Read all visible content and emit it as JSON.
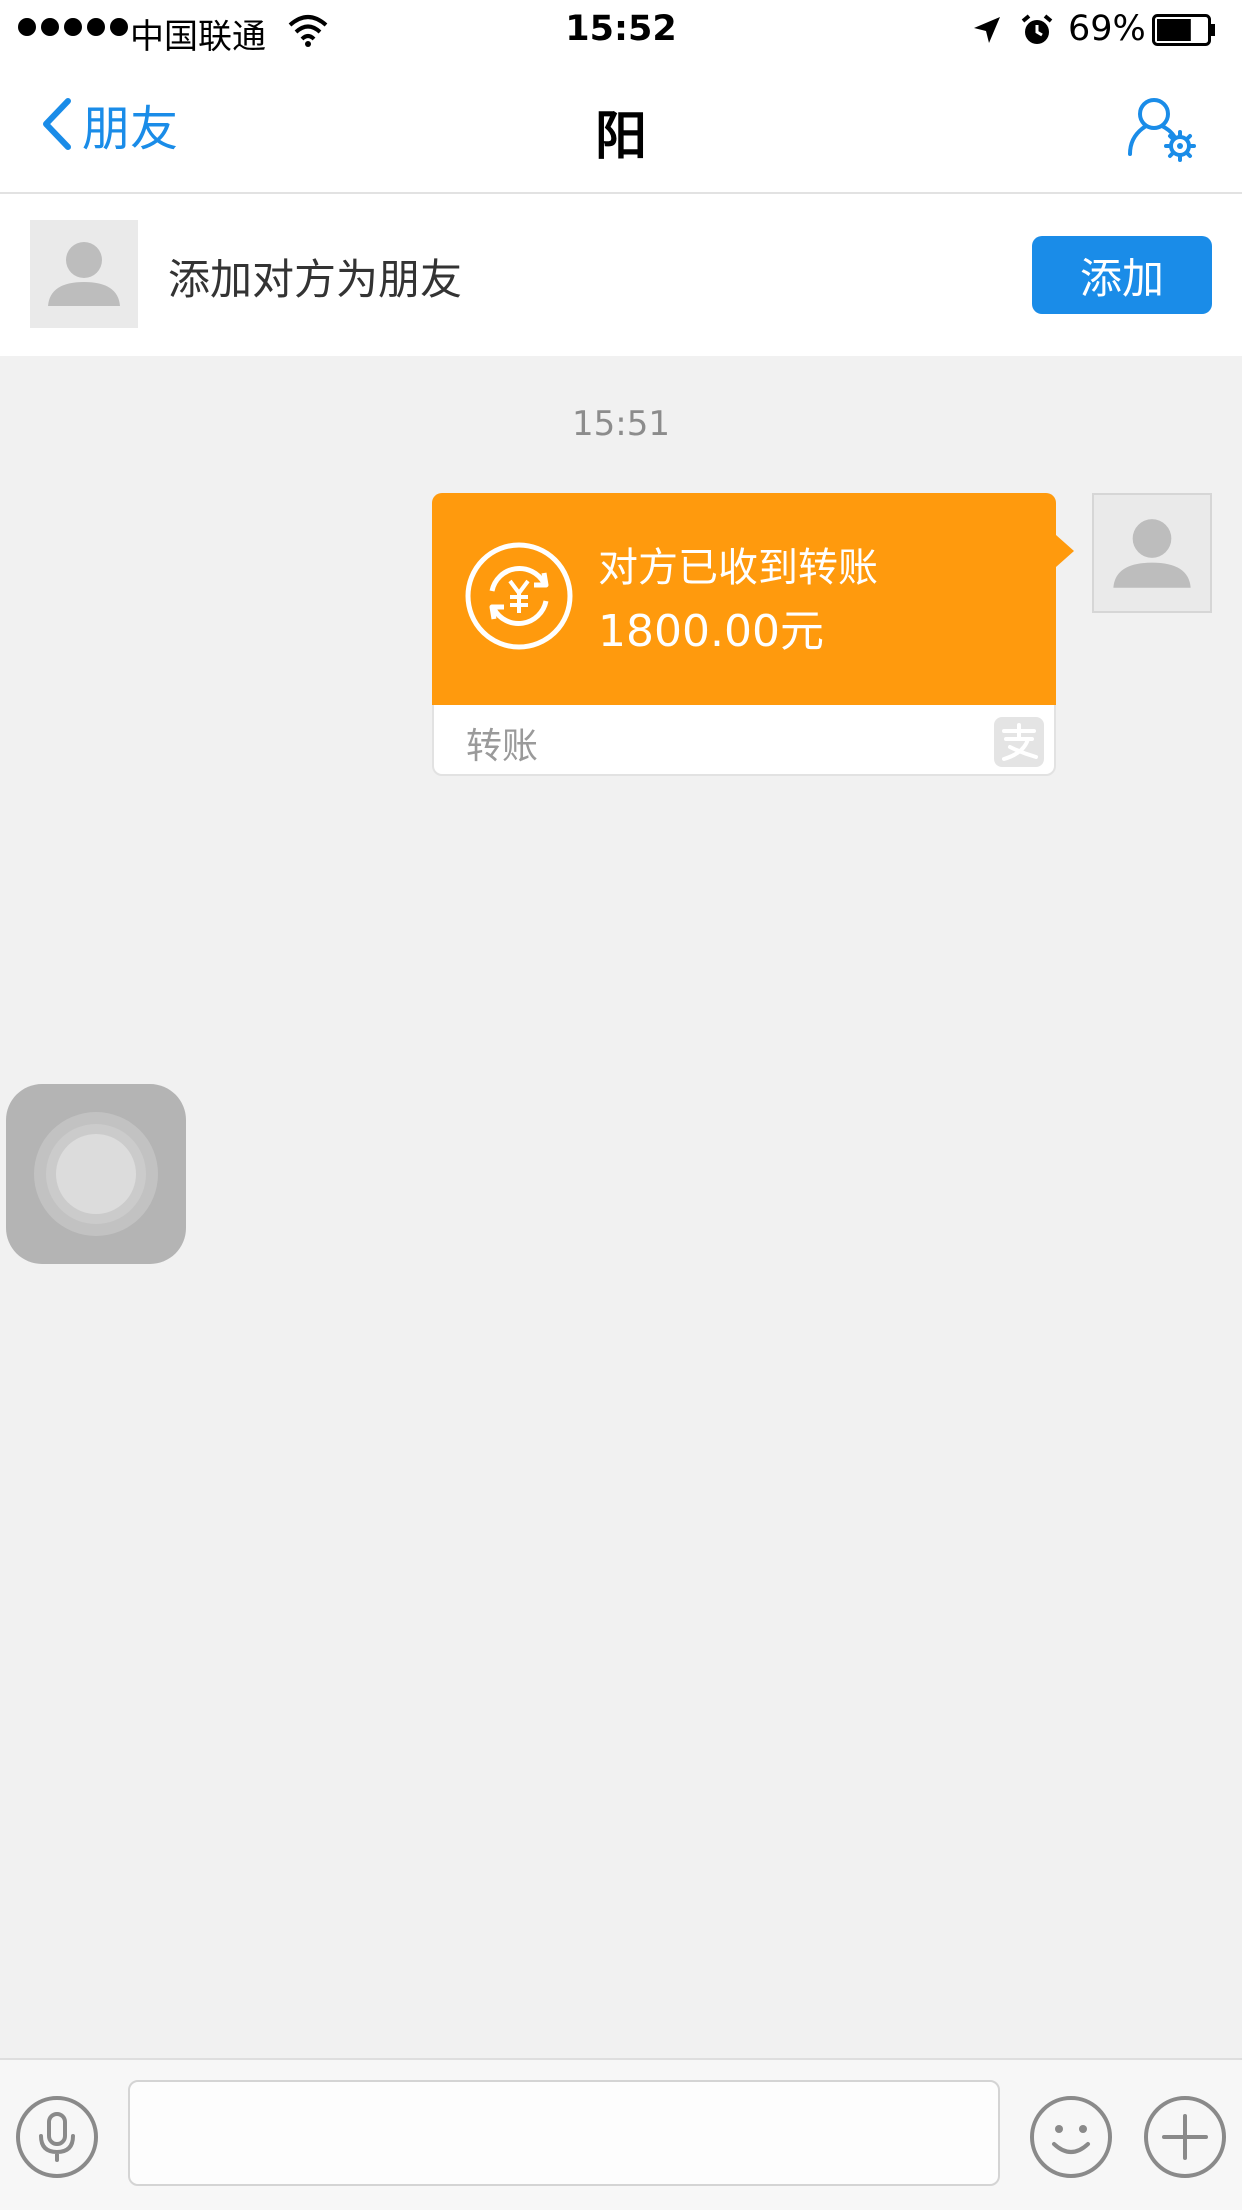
{
  "status_bar": {
    "carrier": "中国联通",
    "time": "15:52",
    "battery_percent": "69%",
    "battery_level": 0.69
  },
  "nav": {
    "back_label": "朋友",
    "title": "阳",
    "accent_color": "#1a8ce8"
  },
  "add_friend": {
    "prompt": "添加对方为朋友",
    "button_label": "添加"
  },
  "chat": {
    "timestamp": "15:51",
    "messages": [
      {
        "type": "transfer",
        "status": "对方已收到转账",
        "amount": "1800.00元",
        "footer_label": "转账",
        "card_color": "#ff9a0d"
      }
    ]
  },
  "input_bar": {
    "placeholder": ""
  },
  "icons": {
    "back": "chevron-left-icon",
    "settings": "user-settings-icon",
    "transfer": "yuan-exchange-icon",
    "alipay": "alipay-icon",
    "voice": "microphone-icon",
    "emoji": "smiley-icon",
    "plus": "plus-icon"
  }
}
